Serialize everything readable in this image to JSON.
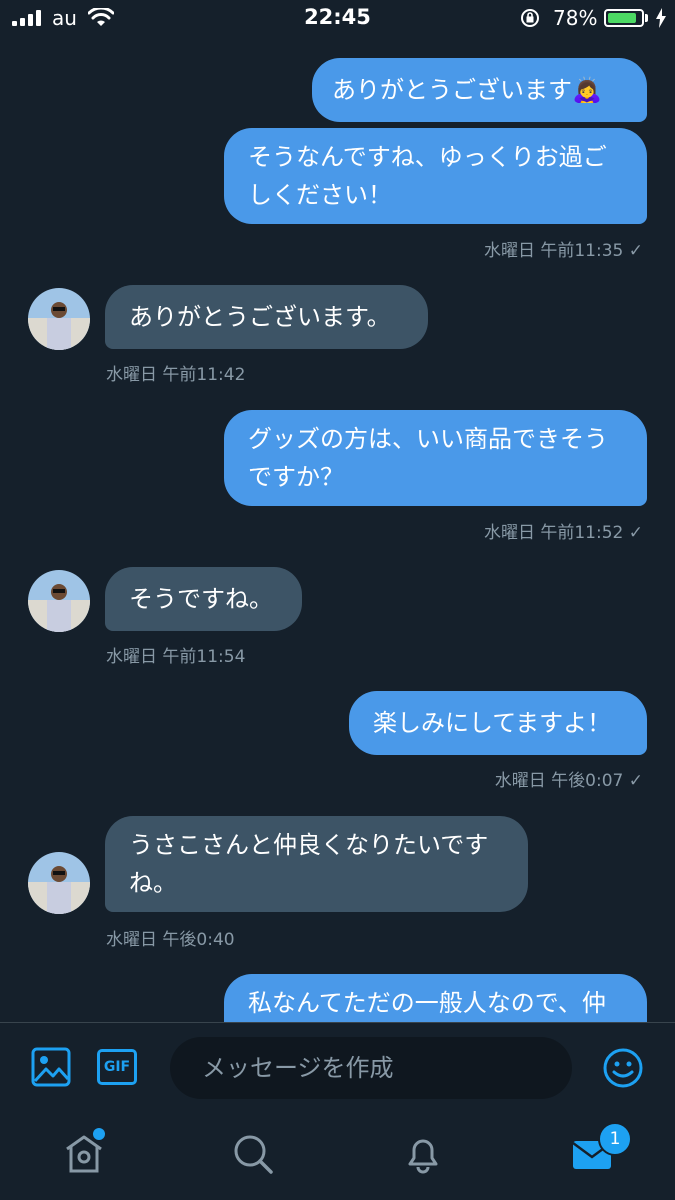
{
  "status_bar": {
    "carrier": "au",
    "time": "22:45",
    "battery_percent": "78%",
    "battery_level": 0.78
  },
  "messages": [
    {
      "dir": "out",
      "text": "ありがとうございます🙇‍♀️"
    },
    {
      "dir": "out",
      "text": "そうなんですね、ゆっくりお過ごしください！",
      "meta": "水曜日 午前11:35 ✓"
    },
    {
      "dir": "in",
      "text": "ありがとうございます。",
      "meta": "水曜日 午前11:42"
    },
    {
      "dir": "out",
      "text": "グッズの方は、いい商品できそうですか？",
      "meta": "水曜日 午前11:52 ✓"
    },
    {
      "dir": "in",
      "text": "そうですね。",
      "meta": "水曜日 午前11:54"
    },
    {
      "dir": "out",
      "text": "楽しみにしてますよ！",
      "meta": "水曜日 午後0:07 ✓"
    },
    {
      "dir": "in",
      "text": "うさこさんと仲良くなりたいですね。",
      "meta": "水曜日 午後0:40"
    },
    {
      "dir": "out",
      "text": "私なんてただの一般人なので、仲"
    }
  ],
  "composer": {
    "placeholder": "メッセージを作成",
    "gif_label": "GIF",
    "icons": [
      "image-icon",
      "gif-icon",
      "emoji-icon"
    ]
  },
  "tabbar": {
    "icons": [
      "home-icon",
      "search-icon",
      "notifications-icon",
      "messages-icon"
    ],
    "messages_badge": "1"
  },
  "colors": {
    "background": "#15202b",
    "outgoing_bubble": "#4a99e9",
    "incoming_bubble": "#3d5466",
    "accent": "#1da1f2",
    "meta_text": "#8899a6"
  }
}
